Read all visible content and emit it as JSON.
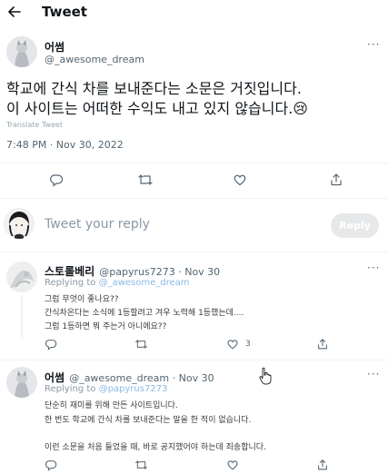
{
  "header": {
    "title": "Tweet"
  },
  "tweet": {
    "author_name": "어썸",
    "author_handle": "@_awesome_dream",
    "text_lines": [
      "학교에 간식 차를 보내준다는 소문은 거짓입니다.",
      "이 사이트는 어떠한 수익도 내고 있지 않습니다.😢"
    ],
    "translate_label": "Translate Tweet",
    "timestamp": "7:48 PM · Nov 30, 2022"
  },
  "composer": {
    "placeholder": "Tweet your reply",
    "reply_button": "Reply"
  },
  "replies": [
    {
      "name": "스토롤베리",
      "handle_time": "@papyrus7273 · Nov 30",
      "replying_prefix": "Replying to ",
      "replying_to": "@_awesome_dream",
      "lines": [
        "그럼 무엇이 좋나요??",
        "간식차온다는 소식에 1등할려고 겨우 노력해 1등했는데....",
        "그럼 1등하면 뭐 주는거 아니에요??"
      ],
      "like_count": "3"
    },
    {
      "name": "어썸",
      "handle_time": "@_awesome_dream · Nov 30",
      "replying_prefix": "Replying to ",
      "replying_to": "@papyrus7273",
      "lines": [
        "단순히 재미를 위해 만든 사이트입니다.",
        "한 번도 학교에 간식 차를 보내준다는 말을 한 적이 없습니다.",
        "",
        "이런 소문을 처음 들었을 때, 바로 공지했어야 하는데 죄송합니다."
      ]
    }
  ],
  "icons": {
    "back": "arrow-left-icon",
    "reply": "comment-icon",
    "retweet": "retweet-icon",
    "like": "heart-icon",
    "share": "share-icon",
    "more": "more-dots-icon"
  },
  "colors": {
    "text": "#0f1419",
    "secondary": "#536471",
    "mention": "#8ab9e6",
    "reply_button_bg": "#e6e8ea"
  }
}
